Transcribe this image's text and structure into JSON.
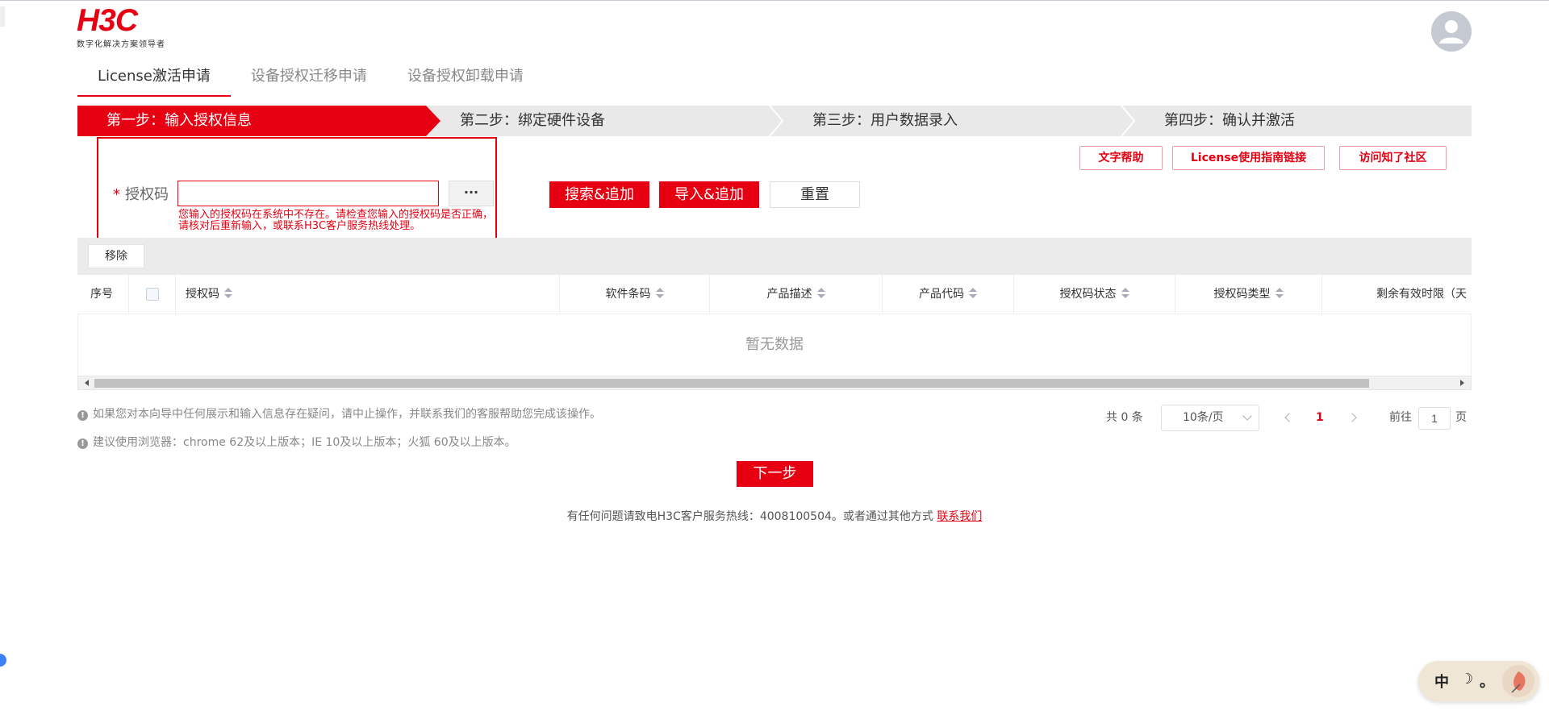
{
  "header": {
    "logo_text": "H3C",
    "logo_slogan": "数字化解决方案领导者"
  },
  "tabs": [
    {
      "label": "License激活申请",
      "active": true
    },
    {
      "label": "设备授权迁移申请",
      "active": false
    },
    {
      "label": "设备授权卸载申请",
      "active": false
    }
  ],
  "steps": [
    {
      "label": "第一步：输入授权信息",
      "active": true
    },
    {
      "label": "第二步：绑定硬件设备",
      "active": false
    },
    {
      "label": "第三步：用户数据录入",
      "active": false
    },
    {
      "label": "第四步：确认并激活",
      "active": false
    }
  ],
  "help_buttons": {
    "text_help": "文字帮助",
    "guide_link": "License使用指南链接",
    "community": "访问知了社区"
  },
  "form": {
    "required_mark": "*",
    "code_label": "授权码",
    "code_value": "",
    "more_button": "···",
    "error": "您输入的授权码在系统中不存在。请检查您输入的授权码是否正确，请核对后重新输入，或联系H3C客户服务热线处理。"
  },
  "actions": {
    "search_add": "搜索&追加",
    "import_add": "导入&追加",
    "reset": "重置"
  },
  "table": {
    "remove_button": "移除",
    "columns": [
      "序号",
      "授权码",
      "软件条码",
      "产品描述",
      "产品代码",
      "授权码状态",
      "授权码类型",
      "剩余有效时限（天"
    ],
    "empty_text": "暂无数据"
  },
  "notes": {
    "note1": "如果您对本向导中任何展示和输入信息存在疑问，请中止操作，并联系我们的客服帮助您完成该操作。",
    "note2": "建议使用浏览器：chrome 62及以上版本；IE 10及以上版本；火狐 60及以上版本。"
  },
  "pagination": {
    "total": "共 0 条",
    "page_size": "10条/页",
    "current_page": "1",
    "goto_label": "前往",
    "goto_value": "1",
    "page_suffix": "页"
  },
  "next_button": "下一步",
  "footer": {
    "text": "有任何问题请致电H3C客户服务热线：4008100504。或者通过其他方式",
    "link": "联系我们"
  },
  "ime": {
    "lang": "中",
    "moon": "☽",
    "punct": "。"
  },
  "colors": {
    "brand_red": "#e60012",
    "step_bg": "#e9e9e9"
  }
}
